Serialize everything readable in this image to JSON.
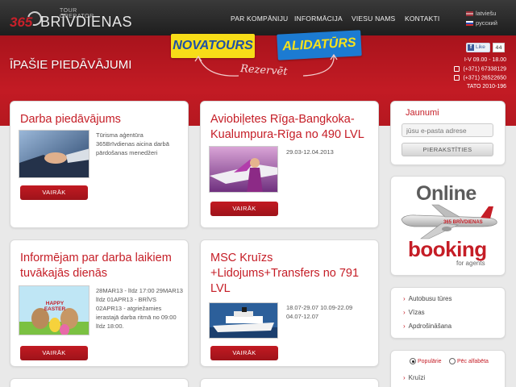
{
  "header": {
    "logo_number": "365",
    "logo_tagline": "TOUR OPERATOR",
    "logo_brand": "BRĪVDIENAS",
    "nav": [
      "PAR KOMPĀNIJU",
      "INFORMĀCIJA",
      "VIESU NAMS",
      "KONTAKTI"
    ],
    "languages": [
      "latviešu",
      "русский"
    ]
  },
  "banner": {
    "title": "ĪPAŠIE PIEDĀVĀJUMI",
    "partners": [
      "NOVATOURS",
      "ALIDATŪRS"
    ],
    "reserve_text": "Rezervēt",
    "facebook": {
      "like_label": "Like",
      "like_count": "44"
    },
    "contact": {
      "hours": "I-V 09.00 - 18.00",
      "phone1": "(+371) 67338129",
      "phone2": "(+371) 26522650",
      "license": "TATO 2010-196"
    }
  },
  "offers": [
    {
      "title": "Darba piedāvājums",
      "text": "Tūrisma aģentūra 365Brīvdienas aicina darbā pārdošanas menedžeri",
      "button": "VAIRĀK"
    },
    {
      "title": "Aviobiļetes Rīga-Bangkoka-Kualumpura-Rīga no 490 LVL",
      "text": "29.03-12.04.2013",
      "button": "VAIRĀK"
    },
    {
      "title": "Informējam par darba laikiem tuvākajās dienās",
      "text": "28MAR13 - līdz 17:00 29MAR13 līdz 01APR13 - BRĪVS 02APR13 - atgriežamies ierastajā darba ritmā no 09:00 līdz 18:00.",
      "image_caption": "HAPPY EASTER",
      "button": "VAIRĀK"
    },
    {
      "title": "MSC Kruīzs +Lidojums+Transfers no 791 LVL",
      "text": "18.07-29.07 10.09-22.09 04.07-12.07",
      "button": "VAIRĀK"
    }
  ],
  "sidebar": {
    "newsletter_title": "Jaunumi",
    "email_placeholder": "jūsu e-pasta adrese",
    "subscribe_button": "PIERAKSTĪTIES",
    "booking": {
      "online": "Online",
      "plane_label": "365 BRĪVDIENAS",
      "booking": "booking",
      "sub": "for agents"
    },
    "menu": [
      "Autobusu tūres",
      "Vīzas",
      "Apdrošināšana"
    ],
    "sort": {
      "popular": "Populārie",
      "alphabet": "Pēc alfabēta"
    },
    "destinations": [
      "Kruīzi"
    ]
  },
  "colors": {
    "brand_red": "#c51d26",
    "banner_red": "#b51820",
    "topbar": "#2a2a2a"
  }
}
